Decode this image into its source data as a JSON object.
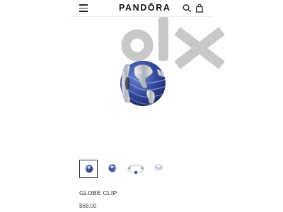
{
  "header": {
    "brand": "PANDŌRA",
    "menu_icon": "hamburger-menu-icon",
    "search_icon": "search-icon",
    "bag_icon": "shopping-bag-icon"
  },
  "watermark": {
    "text": "olx",
    "color": "#c8c8c8"
  },
  "product": {
    "name": "GLOBE CLIP",
    "price": "$68.00",
    "image": "globe-clip-charm-image"
  },
  "gallery": {
    "thumbnails": [
      {
        "name": "thumbnail-globe-clip-front",
        "selected": true
      },
      {
        "name": "thumbnail-globe-clip-angle",
        "selected": false
      },
      {
        "name": "thumbnail-bracelet-with-charm",
        "selected": false
      },
      {
        "name": "thumbnail-globe-clip-side",
        "selected": false
      }
    ]
  },
  "colors": {
    "ocean_blue": "#3a4f9a",
    "silver": "#c9ced6",
    "text": "#222222"
  }
}
